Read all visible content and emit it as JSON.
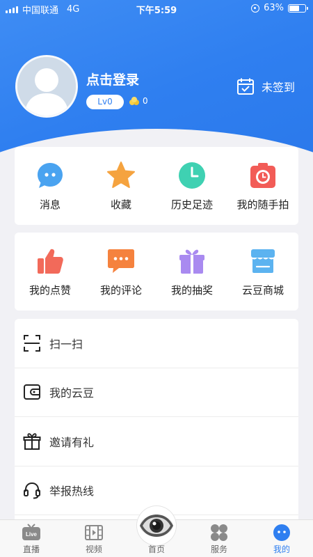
{
  "status_bar": {
    "carrier": "中国联通",
    "network": "4G",
    "time": "下午5:59",
    "battery_percent": "63%",
    "battery_level": 0.63
  },
  "profile": {
    "login_label": "点击登录",
    "level": "Lv0",
    "beans": "0",
    "signin_label": "未签到"
  },
  "quick_actions": [
    {
      "label": "消息",
      "icon": "message-icon"
    },
    {
      "label": "收藏",
      "icon": "star-icon"
    },
    {
      "label": "历史足迹",
      "icon": "clock-icon"
    },
    {
      "label": "我的随手拍",
      "icon": "camera-icon"
    }
  ],
  "activity_actions": [
    {
      "label": "我的点赞",
      "icon": "thumbs-up-icon"
    },
    {
      "label": "我的评论",
      "icon": "comment-icon"
    },
    {
      "label": "我的抽奖",
      "icon": "gift-icon"
    },
    {
      "label": "云豆商城",
      "icon": "shop-icon"
    }
  ],
  "menu": [
    {
      "label": "扫一扫",
      "icon": "scan-icon"
    },
    {
      "label": "我的云豆",
      "icon": "wallet-icon"
    },
    {
      "label": "邀请有礼",
      "icon": "gift-outline-icon"
    },
    {
      "label": "举报热线",
      "icon": "headset-icon"
    }
  ],
  "tabs": [
    {
      "label": "直播",
      "icon": "live-tv-icon",
      "badge": "Live"
    },
    {
      "label": "视频",
      "icon": "film-icon"
    },
    {
      "label": "首页",
      "icon": "eye-logo-icon"
    },
    {
      "label": "服务",
      "icon": "services-icon"
    },
    {
      "label": "我的",
      "icon": "profile-icon",
      "active": true
    }
  ],
  "colors": {
    "brand_blue": "#2f7ff0",
    "message": "#4aa3f0",
    "star": "#f5a33f",
    "clock": "#3fd1b2",
    "camera": "#f25c57",
    "thumbs": "#f26a5a",
    "comment": "#f5823e",
    "gift": "#a98af0",
    "shop": "#5cb3f0"
  }
}
